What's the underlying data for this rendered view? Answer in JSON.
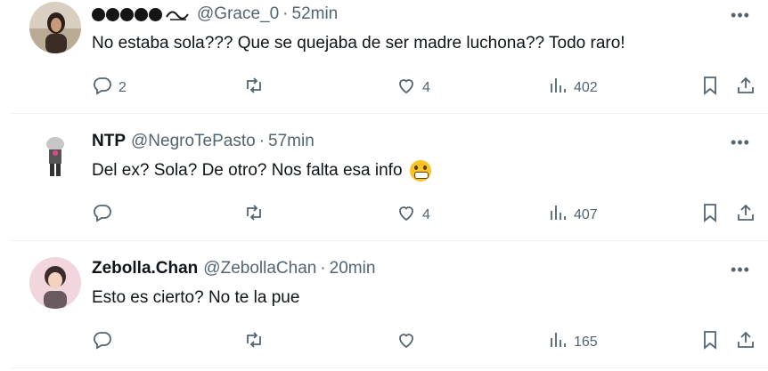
{
  "tweets": [
    {
      "display_name": "",
      "handle": "@Grace_0",
      "separator": "·",
      "time": "52min",
      "text": "No estaba sola??? Que se quejaba de ser madre luchona?? Todo raro!",
      "replies": "2",
      "retweets": "",
      "likes": "4",
      "views": "402"
    },
    {
      "display_name": "NTP",
      "handle": "@NegroTePasto",
      "separator": "·",
      "time": "57min",
      "text": "Del ex? Sola? De otro? Nos falta esa info",
      "replies": "",
      "retweets": "",
      "likes": "4",
      "views": "407"
    },
    {
      "display_name": "Zebolla.Chan",
      "handle": "@ZebollaChan",
      "separator": "·",
      "time": "20min",
      "text": "Esto es cierto? No te la pue",
      "replies": "",
      "retweets": "",
      "likes": "",
      "views": "165"
    }
  ],
  "icons": {
    "more": "more-icon",
    "reply": "reply-icon",
    "retweet": "retweet-icon",
    "like": "heart-icon",
    "views": "views-icon",
    "bookmark": "bookmark-icon",
    "share": "share-icon"
  },
  "colors": {
    "secondary": "#536471",
    "text": "#0f1419",
    "divider": "#eff3f4"
  }
}
